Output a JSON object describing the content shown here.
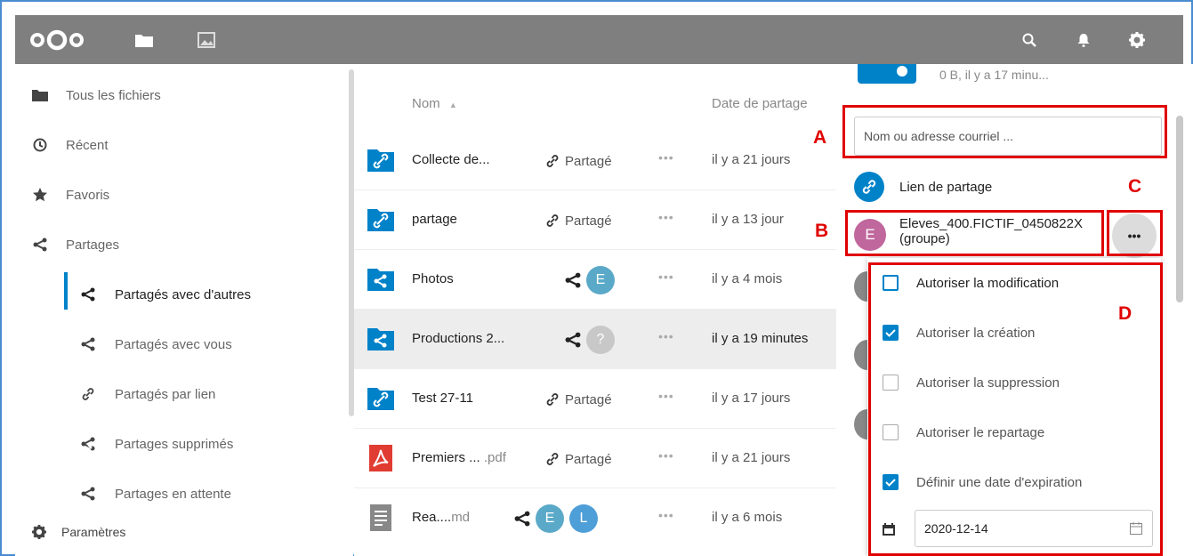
{
  "colors": {
    "header_bg": "#7f7f7f",
    "accent": "#0082c9",
    "annotation_red": "#e00000",
    "avatar_E_group": "#c0679d",
    "avatar_E": "#5aa9c8",
    "avatar_L": "#4e9ed8",
    "avatar_unknown": "#c8c8c8",
    "pdf_red": "#e03c31"
  },
  "header": {
    "icons": [
      "nextcloud-logo",
      "files-folder-icon",
      "photos-image-icon",
      "search-icon",
      "notifications-bell-icon",
      "settings-gear-icon"
    ]
  },
  "sidebar": {
    "items": [
      {
        "label": "Tous les fichiers",
        "icon": "folder-icon"
      },
      {
        "label": "Récent",
        "icon": "clock-icon"
      },
      {
        "label": "Favoris",
        "icon": "star-icon"
      },
      {
        "label": "Partages",
        "icon": "share-icon"
      },
      {
        "label": "Partagés avec d'autres",
        "icon": "share-icon"
      },
      {
        "label": "Partagés avec vous",
        "icon": "share-icon"
      },
      {
        "label": "Partagés par lien",
        "icon": "link-icon"
      },
      {
        "label": "Partages supprimés",
        "icon": "share-deleted-icon"
      },
      {
        "label": "Partages en attente",
        "icon": "share-icon"
      },
      {
        "label": "Paramètres",
        "icon": "gear-icon"
      }
    ]
  },
  "filelist": {
    "col_name": "Nom",
    "col_sort_indicator": "▲",
    "col_date": "Date de partage",
    "rows": [
      {
        "name": "Collecte de...",
        "ext": "",
        "share_label": "Partagé",
        "date": "il y a 21 jours",
        "more": "•••"
      },
      {
        "name": "partage",
        "ext": "",
        "share_label": "Partagé",
        "date": "il y a 13 jour",
        "more": "•••"
      },
      {
        "name": "Photos",
        "ext": "",
        "share_label": "",
        "date": "il y a 4 mois",
        "more": "•••",
        "avatar": "E"
      },
      {
        "name": "Productions 2...",
        "ext": "",
        "share_label": "",
        "date": "il y a 19 minutes",
        "more": "•••",
        "avatar": "?"
      },
      {
        "name": "Test 27-11",
        "ext": "",
        "share_label": "Partagé",
        "date": "il y a 17 jours",
        "more": "•••"
      },
      {
        "name": "Premiers ...",
        "ext": ".pdf",
        "share_label": "Partagé",
        "date": "il y a 21 jours",
        "more": "•••"
      },
      {
        "name": "Rea....",
        "ext": "md",
        "share_label": "",
        "date": "il y a 6 mois",
        "more": "•••",
        "avatars": [
          "E",
          "L"
        ]
      }
    ]
  },
  "panel": {
    "top_info": "0 B, il y a 17 minu...",
    "search_placeholder": "Nom ou adresse courriel ...",
    "link_share_label": "Lien de partage",
    "share_entry_line1": "Eleves_400.FICTIF_0450822X",
    "share_entry_line2": "(groupe)",
    "share_entry_avatar": "E",
    "more_button": "•••"
  },
  "menu": {
    "items": [
      {
        "label": "Autoriser la modification",
        "checked": false
      },
      {
        "label": "Autoriser la création",
        "checked": true
      },
      {
        "label": "Autoriser la suppression",
        "checked": false
      },
      {
        "label": "Autoriser le repartage",
        "checked": false
      },
      {
        "label": "Définir une date d'expiration",
        "checked": true
      }
    ],
    "expiration_date": "2020-12-14"
  },
  "annotations": {
    "A": "A",
    "B": "B",
    "C": "C",
    "D": "D"
  }
}
